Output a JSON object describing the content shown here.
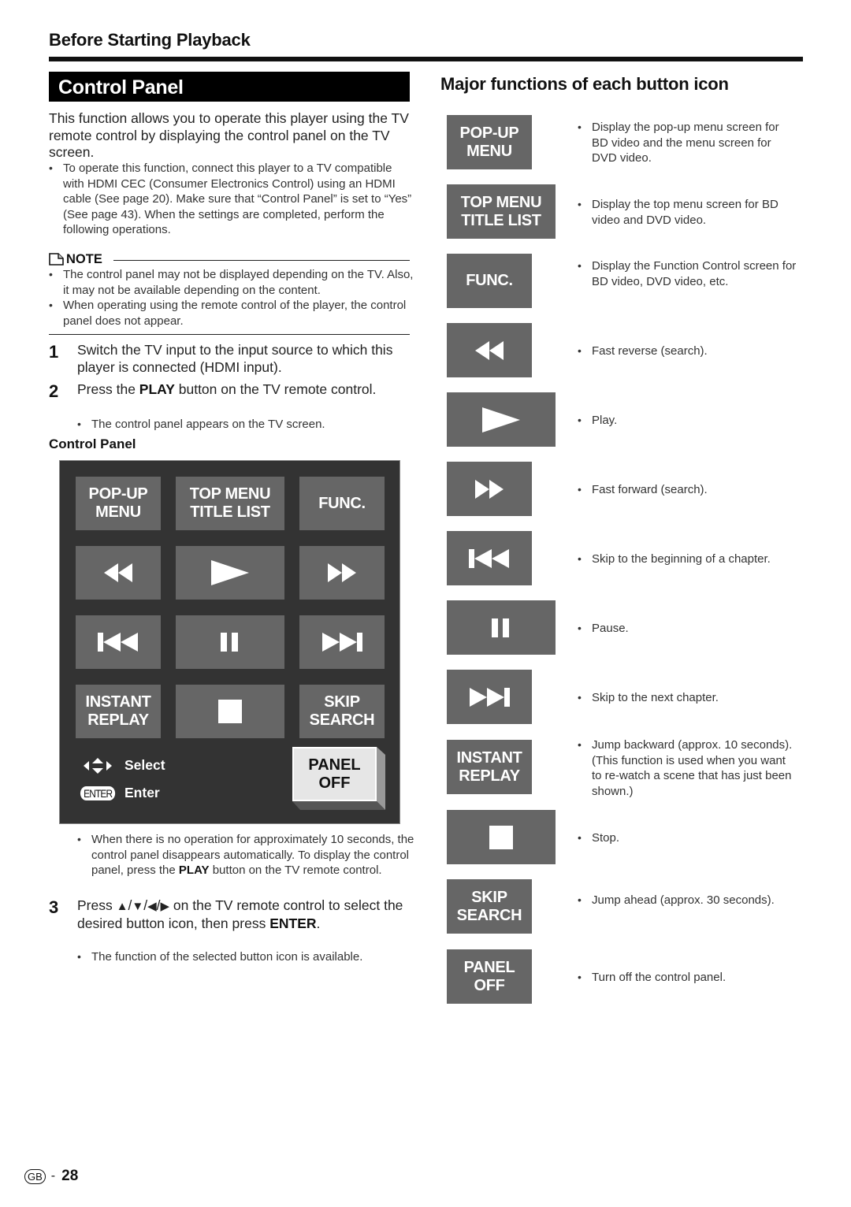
{
  "header": {
    "section_title": "Before Starting Playback",
    "page_title": "Control Panel"
  },
  "intro": {
    "text": "This function allows you to operate this player using the TV remote control by displaying the control panel on the TV screen.",
    "bullets": [
      "To operate this function, connect this player to a TV compatible with HDMI CEC (Consumer Electronics Control) using an HDMI cable (See page 20). Make sure that “Control Panel” is set to “Yes” (See page 43). When the settings are completed, perform the following operations."
    ]
  },
  "note": {
    "icon": "note-icon",
    "label": "NOTE",
    "bullets": [
      "The control panel may not be displayed depending on the TV. Also, it may not be available depending on the content.",
      "When operating using the remote control of the player, the control panel does not appear."
    ]
  },
  "steps": [
    {
      "number": "1",
      "text": "Switch the TV input to the input source to which this player is connected (HDMI input)."
    },
    {
      "number": "2",
      "text_before": "Press the ",
      "bold": "PLAY",
      "text_after": " button on the TV remote control.",
      "bullets": [
        "The control panel appears on the TV screen."
      ]
    },
    {
      "number": "3",
      "text_before": "Press ",
      "arrows": [
        "▲",
        "▼",
        "◀",
        "▶"
      ],
      "separator": "/",
      "text_middle": " on the TV remote control to select the desired button icon, then press ",
      "bold": "ENTER",
      "text_after": ".",
      "bullets": [
        "The function of the selected button icon is available."
      ]
    }
  ],
  "control_panel": {
    "label": "Control Panel",
    "buttons": {
      "popup_menu": [
        "POP-UP",
        "MENU"
      ],
      "top_menu": [
        "TOP MENU",
        "TITLE LIST"
      ],
      "func": [
        "FUNC."
      ],
      "instant_replay": [
        "INSTANT",
        "REPLAY"
      ],
      "skip_search": [
        "SKIP",
        "SEARCH"
      ],
      "panel_off": [
        "PANEL",
        "OFF"
      ]
    },
    "icons": [
      "fast-reverse-icon",
      "play-icon",
      "fast-forward-icon",
      "skip-back-icon",
      "pause-icon",
      "skip-next-icon",
      "stop-icon"
    ],
    "legend": {
      "select_label": "Select",
      "enter_badge": "ENTER",
      "enter_label": "Enter"
    }
  },
  "after_panel_note": {
    "text_before": "When there is no operation for approximately 10 seconds, the control panel disappears automatically. To display the control panel, press the ",
    "bold": "PLAY",
    "text_after": " button on the TV remote control."
  },
  "functions": {
    "heading": "Major functions of each button icon",
    "items": [
      {
        "icon": "popup-menu",
        "label": [
          "POP-UP",
          "MENU"
        ],
        "description": "Display the pop-up menu screen for BD video and the menu screen for DVD video."
      },
      {
        "icon": "top-menu",
        "label": [
          "TOP MENU",
          "TITLE LIST"
        ],
        "description": "Display the top menu screen for BD video and DVD video."
      },
      {
        "icon": "func",
        "label": [
          "FUNC."
        ],
        "description": "Display the Function Control screen for BD video, DVD video, etc."
      },
      {
        "icon": "fast-reverse-icon",
        "label": [],
        "description": "Fast reverse (search)."
      },
      {
        "icon": "play-icon",
        "label": [],
        "description": "Play."
      },
      {
        "icon": "fast-forward-icon",
        "label": [],
        "description": "Fast forward (search)."
      },
      {
        "icon": "skip-back-icon",
        "label": [],
        "description": "Skip to the beginning of a chapter."
      },
      {
        "icon": "pause-icon",
        "label": [],
        "description": "Pause."
      },
      {
        "icon": "skip-next-icon",
        "label": [],
        "description": "Skip to the next chapter."
      },
      {
        "icon": "instant-replay",
        "label": [
          "INSTANT",
          "REPLAY"
        ],
        "description": "Jump backward (approx. 10 seconds). (This function is used when you want to re-watch a scene that has just been shown.)"
      },
      {
        "icon": "stop-icon",
        "label": [],
        "description": "Stop."
      },
      {
        "icon": "skip-search",
        "label": [
          "SKIP",
          "SEARCH"
        ],
        "description": "Jump ahead (approx. 30 seconds)."
      },
      {
        "icon": "panel-off",
        "label": [
          "PANEL",
          "OFF"
        ],
        "description": "Turn off the control panel."
      }
    ]
  },
  "footer": {
    "region_badge": "GB",
    "separator": "-",
    "page_number": "28"
  },
  "colors": {
    "panel_bg": "#333333",
    "button_bg": "#666666",
    "panel_off_bg": "#e6e6e6",
    "title_bar_bg": "#000000"
  }
}
